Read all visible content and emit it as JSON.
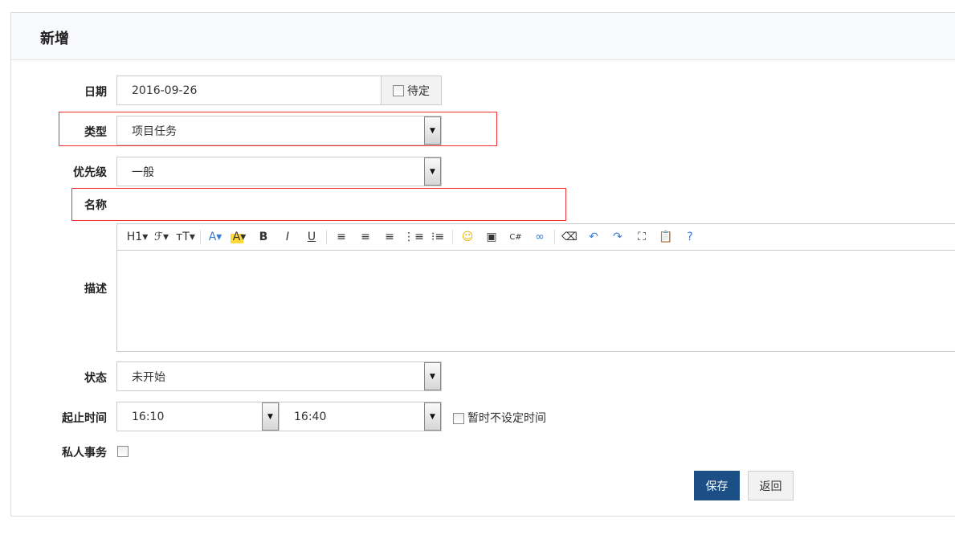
{
  "header": {
    "title": "新增"
  },
  "form": {
    "date": {
      "label": "日期",
      "value": "2016-09-26",
      "pending_label": "待定"
    },
    "type": {
      "label": "类型",
      "value": "项目任务"
    },
    "priority": {
      "label": "优先级",
      "value": "一般"
    },
    "name": {
      "label": "名称"
    },
    "description": {
      "label": "描述"
    },
    "status": {
      "label": "状态",
      "value": "未开始"
    },
    "time": {
      "label": "起止时间",
      "start": "16:10",
      "end": "16:40",
      "no_time_label": "暂时不设定时间"
    },
    "private": {
      "label": "私人事务"
    }
  },
  "toolbar": [
    {
      "icon": "heading-icon",
      "glyph": "H1▾"
    },
    {
      "icon": "font-family-icon",
      "glyph": "ℱ▾"
    },
    {
      "icon": "font-size-icon",
      "glyph": "тT▾"
    },
    {
      "sep": true
    },
    {
      "icon": "font-color-icon",
      "glyph": "A▾"
    },
    {
      "icon": "highlight-icon",
      "glyph": "A▾"
    },
    {
      "icon": "bold-icon",
      "glyph": "B"
    },
    {
      "icon": "italic-icon",
      "glyph": "I"
    },
    {
      "icon": "underline-icon",
      "glyph": "U"
    },
    {
      "sep": true
    },
    {
      "icon": "align-left-icon",
      "glyph": "≡"
    },
    {
      "icon": "align-center-icon",
      "glyph": "≡"
    },
    {
      "icon": "align-right-icon",
      "glyph": "≡"
    },
    {
      "icon": "ordered-list-icon",
      "glyph": "⋮≡"
    },
    {
      "icon": "unordered-list-icon",
      "glyph": "⁝≡"
    },
    {
      "sep": true
    },
    {
      "icon": "emoji-icon",
      "glyph": "☺"
    },
    {
      "icon": "image-icon",
      "glyph": "▣"
    },
    {
      "icon": "code-icon",
      "glyph": "C#"
    },
    {
      "icon": "link-icon",
      "glyph": "∞"
    },
    {
      "sep": true
    },
    {
      "icon": "eraser-icon",
      "glyph": "⌫"
    },
    {
      "icon": "undo-icon",
      "glyph": "↶"
    },
    {
      "icon": "redo-icon",
      "glyph": "↷"
    },
    {
      "icon": "fullscreen-icon",
      "glyph": "⛶"
    },
    {
      "icon": "paste-icon",
      "glyph": "📋"
    },
    {
      "icon": "help-icon",
      "glyph": "?"
    }
  ],
  "buttons": {
    "save": "保存",
    "back": "返回"
  },
  "colors": {
    "primary": "#1c4f86",
    "highlight": "#e33"
  }
}
